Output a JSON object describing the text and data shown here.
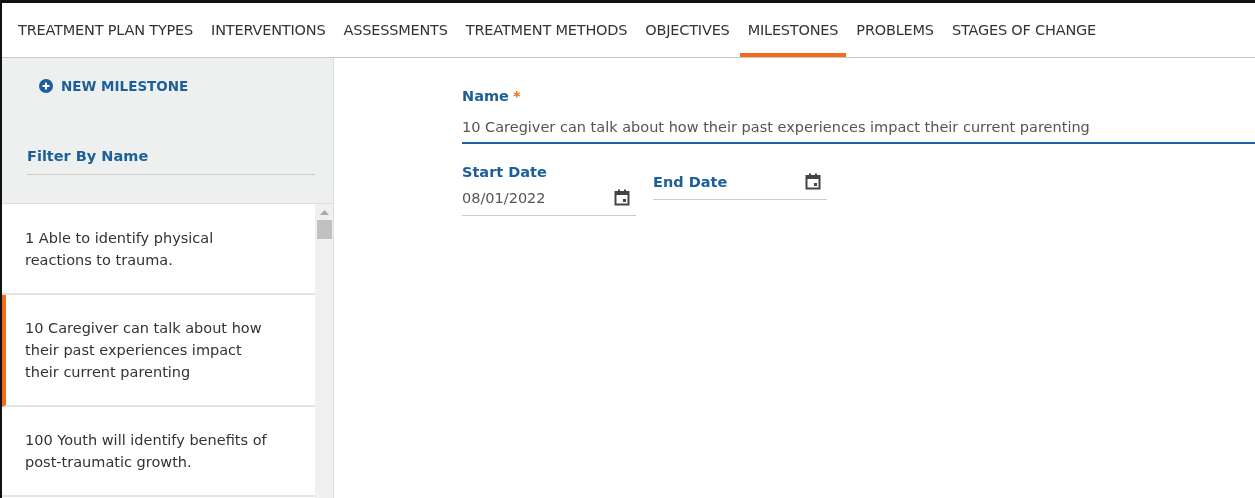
{
  "tabs": [
    {
      "label": "TREATMENT PLAN TYPES",
      "selected": false
    },
    {
      "label": "INTERVENTIONS",
      "selected": false
    },
    {
      "label": "ASSESSMENTS",
      "selected": false
    },
    {
      "label": "TREATMENT METHODS",
      "selected": false
    },
    {
      "label": "OBJECTIVES",
      "selected": false
    },
    {
      "label": "MILESTONES",
      "selected": true
    },
    {
      "label": "PROBLEMS",
      "selected": false
    },
    {
      "label": "STAGES OF CHANGE",
      "selected": false
    }
  ],
  "sidebar": {
    "new_button": "NEW MILESTONE",
    "filter": {
      "placeholder": "Filter By Name"
    },
    "items": [
      {
        "text": "1 Able to identify physical reactions to trauma.",
        "selected": false
      },
      {
        "text": "10 Caregiver can talk about how their past experiences impact their current parenting",
        "selected": true
      },
      {
        "text": "100 Youth will identify benefits of post-traumatic growth.",
        "selected": false
      }
    ]
  },
  "form": {
    "name": {
      "label": "Name",
      "required_mark": "*",
      "value": "10 Caregiver can talk about how their past experiences impact their current parenting "
    },
    "start_date": {
      "label": "Start Date",
      "value": "08/01/2022"
    },
    "end_date": {
      "placeholder": "End Date"
    }
  }
}
